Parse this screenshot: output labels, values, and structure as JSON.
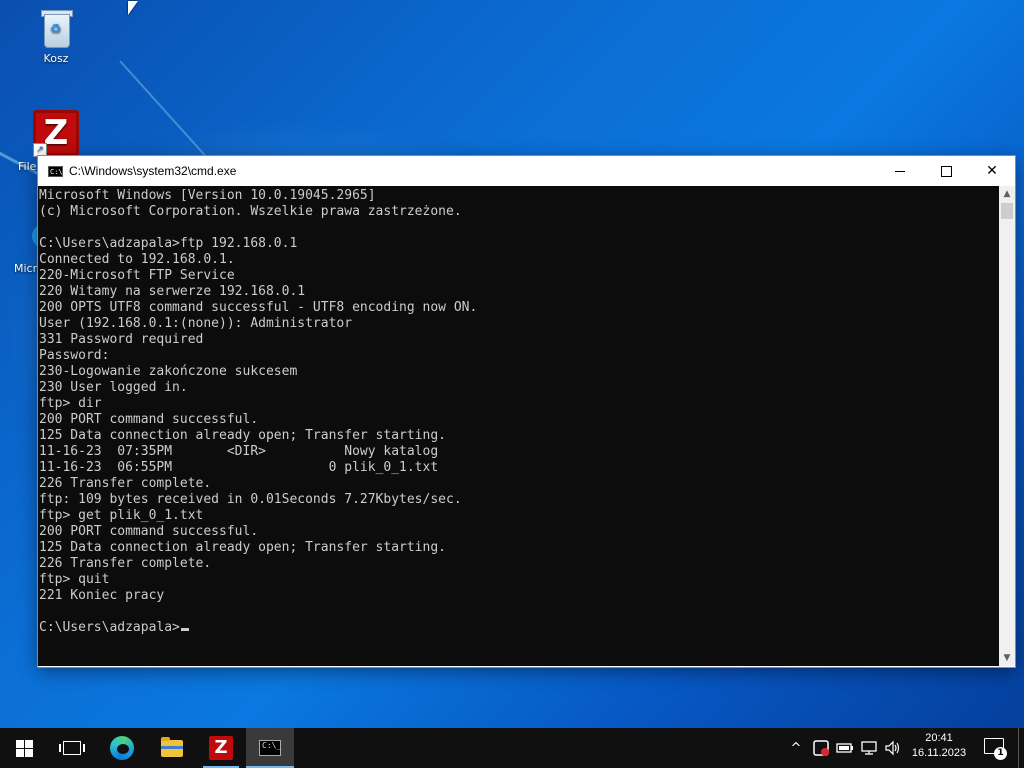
{
  "desktop": {
    "icons": [
      {
        "label": "Kosz",
        "icon": "recycle-bin-icon"
      },
      {
        "label": "File",
        "icon": "filezilla-icon"
      },
      {
        "label": "Micr",
        "icon": "edge-icon"
      }
    ]
  },
  "cmd_window": {
    "title": "C:\\Windows\\system32\\cmd.exe",
    "icon": "console-icon",
    "buttons": {
      "minimize": "minimize",
      "maximize": "maximize",
      "close": "✕"
    },
    "lines": [
      "Microsoft Windows [Version 10.0.19045.2965]",
      "(c) Microsoft Corporation. Wszelkie prawa zastrzeżone.",
      "",
      "C:\\Users\\adzapala>ftp 192.168.0.1",
      "Connected to 192.168.0.1.",
      "220-Microsoft FTP Service",
      "220 Witamy na serwerze 192.168.0.1",
      "200 OPTS UTF8 command successful - UTF8 encoding now ON.",
      "User (192.168.0.1:(none)): Administrator",
      "331 Password required",
      "Password:",
      "230-Logowanie zakończone sukcesem",
      "230 User logged in.",
      "ftp> dir",
      "200 PORT command successful.",
      "125 Data connection already open; Transfer starting.",
      "11-16-23  07:35PM       <DIR>          Nowy katalog",
      "11-16-23  06:55PM                    0 plik_0_1.txt",
      "226 Transfer complete.",
      "ftp: 109 bytes received in 0.01Seconds 7.27Kbytes/sec.",
      "ftp> get plik_0_1.txt",
      "200 PORT command successful.",
      "125 Data connection already open; Transfer starting.",
      "226 Transfer complete.",
      "ftp> quit",
      "221 Koniec pracy",
      ""
    ],
    "prompt": "C:\\Users\\adzapala>"
  },
  "taskbar": {
    "apps": [
      {
        "name": "start",
        "icon": "windows-logo-icon"
      },
      {
        "name": "task-view",
        "icon": "task-view-icon"
      },
      {
        "name": "edge",
        "icon": "edge-icon"
      },
      {
        "name": "file-explorer",
        "icon": "folder-icon"
      },
      {
        "name": "filezilla",
        "icon": "filezilla-icon"
      },
      {
        "name": "cmd",
        "icon": "console-icon"
      }
    ],
    "tray": {
      "chevron": "^",
      "icons": [
        "security-icon",
        "battery-icon",
        "network-icon",
        "volume-icon"
      ]
    },
    "clock": {
      "time": "20:41",
      "date": "16.11.2023"
    },
    "notifications": {
      "count": "1"
    }
  },
  "colors": {
    "console_bg": "#0c0c0c",
    "console_text": "#cccccc",
    "taskbar_bg": "#101010",
    "accent": "#76b9ed",
    "filezilla_red": "#bf0b0b"
  }
}
